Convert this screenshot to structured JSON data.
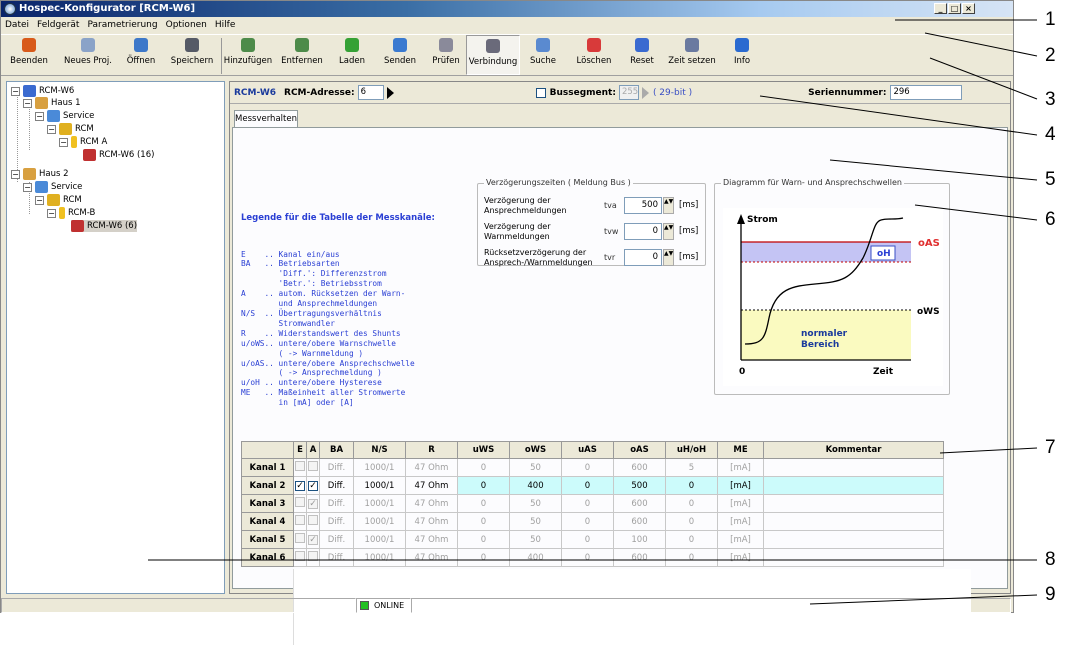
{
  "title": "Hospec-Konfigurator [RCM-W6]",
  "window_buttons": [
    "_",
    "□",
    "×"
  ],
  "menu": [
    "Datei",
    "Feldgerät",
    "Parametrierung",
    "Optionen",
    "Hilfe"
  ],
  "toolbar": [
    {
      "label": "Beenden",
      "icon": "power-icon",
      "color": "#d85a1a"
    },
    {
      "label": "Neues Proj.",
      "icon": "new-file-icon",
      "color": "#8aa3c8"
    },
    {
      "label": "Öffnen",
      "icon": "open-folder-icon",
      "color": "#3d78c9"
    },
    {
      "label": "Speichern",
      "icon": "floppy-disk-icon",
      "color": "#555a66"
    },
    {
      "label": "Hinzufügen",
      "icon": "add-device-icon",
      "color": "#4d8b4a"
    },
    {
      "label": "Entfernen",
      "icon": "remove-device-icon",
      "color": "#4d8b4a"
    },
    {
      "label": "Laden",
      "icon": "download-icon",
      "color": "#35a135"
    },
    {
      "label": "Senden",
      "icon": "upload-icon",
      "color": "#3a7ad0"
    },
    {
      "label": "Prüfen",
      "icon": "check-gear-icon",
      "color": "#8a8a9a"
    },
    {
      "label": "Verbindung",
      "icon": "connection-plug-icon",
      "color": "#6a6a7a"
    },
    {
      "label": "Suche",
      "icon": "search-icon",
      "color": "#5a8ad0"
    },
    {
      "label": "Löschen",
      "icon": "delete-icon",
      "color": "#d83a3a"
    },
    {
      "label": "Reset",
      "icon": "reset-icon",
      "color": "#3a6ad0"
    },
    {
      "label": "Zeit setzen",
      "icon": "clock-icon",
      "color": "#6a7aa0"
    },
    {
      "label": "Info",
      "icon": "info-icon",
      "color": "#2a6ad0"
    }
  ],
  "tree": {
    "root": "RCM-W6",
    "haus1": "Haus 1",
    "service1": "Service",
    "rcm1": "RCM",
    "rcma": "RCM A",
    "dev1": "RCM-W6 (16)",
    "haus2": "Haus 2",
    "service2": "Service",
    "rcm2": "RCM",
    "rcmb": "RCM-B",
    "dev2": "RCM-W6 (6)"
  },
  "header": {
    "device": "RCM-W6",
    "addr_label": "RCM-Adresse:",
    "addr_value": "6",
    "bus_label": "Bussegment:",
    "bus_value": "255",
    "bus_bits": "( 29-bit )",
    "serial_label": "Seriennummer:",
    "serial_value": "296"
  },
  "tab": "Messverhalten",
  "legend_title": "Legende für die Tabelle der Messkanäle:",
  "legend_lines": [
    "E    .. Kanal ein/aus",
    "BA   .. Betriebsarten",
    "        'Diff.': Differenzstrom",
    "        'Betr.': Betriebsstrom",
    "A    .. autom. Rücksetzen der Warn-",
    "        und Ansprechmeldungen",
    "N/S  .. Übertragungsverhältnis",
    "        Stromwandler",
    "R    .. Widerstandswert des Shunts",
    "u/oWS.. untere/obere Warnschwelle",
    "        ( -> Warnmeldung )",
    "u/oAS.. untere/obere Ansprechschwelle",
    "        ( -> Ansprechmeldung )",
    "u/oH .. untere/obere Hysterese",
    "ME   .. Maßeinheit aller Stromwerte",
    "        in [mA] oder [A]"
  ],
  "delays": {
    "title": "Verzögerungszeiten ( Meldung Bus )",
    "rows": [
      {
        "label1": "Verzögerung der",
        "label2": "Ansprechmeldungen",
        "sym": "tva",
        "value": "500",
        "unit": "[ms]"
      },
      {
        "label1": "Verzögerung der",
        "label2": "Warnmeldungen",
        "sym": "tvw",
        "value": "0",
        "unit": "[ms]"
      },
      {
        "label1": "Rücksetzverzögerung der",
        "label2": "Ansprech-/Warnmeldungen",
        "sym": "tvr",
        "value": "0",
        "unit": "[ms]"
      }
    ]
  },
  "diagram": {
    "title": "Diagramm für Warn- und Ansprechschwellen",
    "y": "Strom",
    "x": "Zeit",
    "zero": "0",
    "oAS": "oAS",
    "oH": "oH",
    "oWS": "oWS",
    "normal1": "normaler",
    "normal2": "Bereich"
  },
  "table": {
    "headers": [
      "",
      "E",
      "A",
      "BA",
      "N/S",
      "R",
      "uWS",
      "oWS",
      "uAS",
      "oAS",
      "uH/oH",
      "ME",
      "Kommentar"
    ],
    "rows": [
      {
        "name": "Kanal 1",
        "E": false,
        "A": false,
        "BA": "Diff.",
        "NS": "1000/1",
        "R": "47 Ohm",
        "uWS": "0",
        "oWS": "50",
        "uAS": "0",
        "oAS": "600",
        "uH": "5",
        "ME": "[mA]",
        "K": "",
        "active": false
      },
      {
        "name": "Kanal 2",
        "E": true,
        "A": true,
        "BA": "Diff.",
        "NS": "1000/1",
        "R": "47 Ohm",
        "uWS": "0",
        "oWS": "400",
        "uAS": "0",
        "oAS": "500",
        "uH": "0",
        "ME": "[mA]",
        "K": "",
        "active": true
      },
      {
        "name": "Kanal 3",
        "E": false,
        "A": true,
        "BA": "Diff.",
        "NS": "1000/1",
        "R": "47 Ohm",
        "uWS": "0",
        "oWS": "50",
        "uAS": "0",
        "oAS": "600",
        "uH": "0",
        "ME": "[mA]",
        "K": "",
        "active": false
      },
      {
        "name": "Kanal 4",
        "E": false,
        "A": false,
        "BA": "Diff.",
        "NS": "1000/1",
        "R": "47 Ohm",
        "uWS": "0",
        "oWS": "50",
        "uAS": "0",
        "oAS": "600",
        "uH": "0",
        "ME": "[mA]",
        "K": "",
        "active": false
      },
      {
        "name": "Kanal 5",
        "E": false,
        "A": true,
        "BA": "Diff.",
        "NS": "1000/1",
        "R": "47 Ohm",
        "uWS": "0",
        "oWS": "50",
        "uAS": "0",
        "oAS": "100",
        "uH": "0",
        "ME": "[mA]",
        "K": "",
        "active": false
      },
      {
        "name": "Kanal 6",
        "E": false,
        "A": false,
        "BA": "Diff.",
        "NS": "1000/1",
        "R": "47 Ohm",
        "uWS": "0",
        "oWS": "400",
        "uAS": "0",
        "oAS": "600",
        "uH": "0",
        "ME": "[mA]",
        "K": "",
        "active": false
      }
    ]
  },
  "status": {
    "online": "ONLINE",
    "online_color": "#22c022"
  },
  "callouts": [
    "1",
    "2",
    "3",
    "4",
    "5",
    "6",
    "7",
    "8",
    "9"
  ]
}
